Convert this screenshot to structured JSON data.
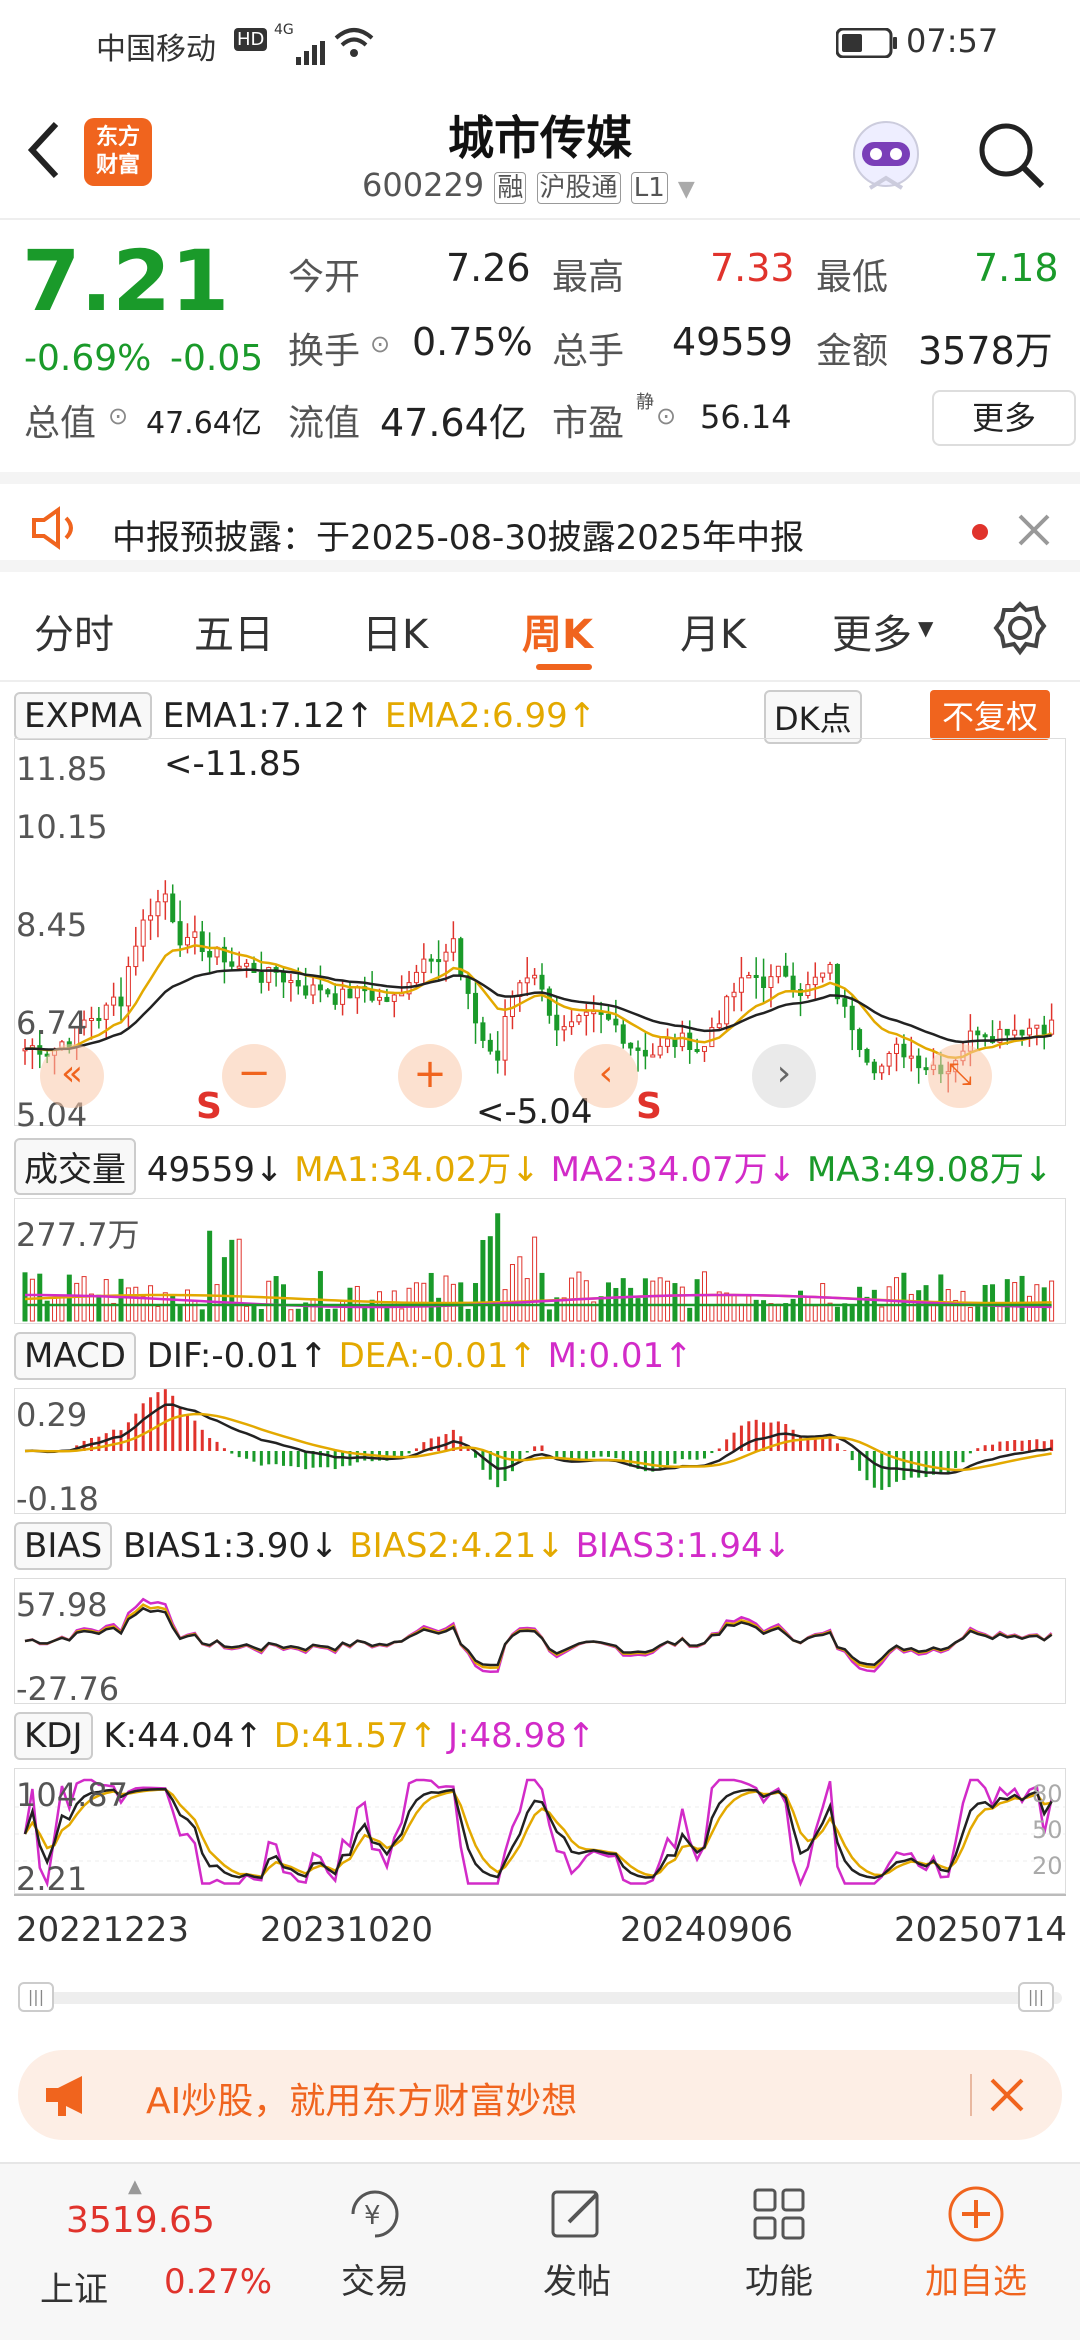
{
  "status_bar": {
    "carrier": "中国移动",
    "hd": "HD",
    "signal_tag": "4G",
    "time": "07:57"
  },
  "header": {
    "logo_text_1": "东方",
    "logo_text_2": "财富",
    "stock_name": "城市传媒",
    "stock_code": "600229",
    "tag_margin": "融",
    "tag_connect": "沪股通",
    "tag_level": "L1"
  },
  "quote": {
    "price": "7.21",
    "change_pct": "-0.69%",
    "change_amt": "-0.05",
    "open_label": "今开",
    "open": "7.26",
    "high_label": "最高",
    "high": "7.33",
    "low_label": "最低",
    "low": "7.18",
    "turnover_label": "换手",
    "turnover": "0.75%",
    "volume_label": "总手",
    "volume": "49559",
    "amount_label": "金额",
    "amount": "3578万",
    "mktcap_label": "总值",
    "mktcap": "47.64亿",
    "float_label": "流值",
    "float_cap": "47.64亿",
    "pe_label": "市盈",
    "pe_sup": "静",
    "pe": "56.14",
    "more": "更多"
  },
  "notice": {
    "text": "中报预披露：于2025-08-30披露2025年中报"
  },
  "tabs": [
    "分时",
    "五日",
    "日K",
    "周K",
    "月K",
    "更多"
  ],
  "active_tab": "周K",
  "main_chart": {
    "indicator": "EXPMA",
    "ema1": "EMA1:7.12↑",
    "ema2": "EMA2:6.99↑",
    "dk_btn": "DK点",
    "fq_btn": "不复权",
    "y_ticks": [
      "11.85",
      "10.15",
      "8.45",
      "6.74",
      "5.04"
    ],
    "max_label": "<-11.85",
    "min_label": "<-5.04",
    "s_marker": "S"
  },
  "volume_panel": {
    "indicator": "成交量",
    "value": "49559↓",
    "ma1": "MA1:34.02万↓",
    "ma2": "MA2:34.07万↓",
    "ma3": "MA3:49.08万↓",
    "y_top": "277.7万"
  },
  "macd_panel": {
    "indicator": "MACD",
    "dif": "DIF:-0.01↑",
    "dea": "DEA:-0.01↑",
    "m": "M:0.01↑",
    "y_top": "0.29",
    "y_bot": "-0.18"
  },
  "bias_panel": {
    "indicator": "BIAS",
    "b1": "BIAS1:3.90↓",
    "b2": "BIAS2:4.21↓",
    "b3": "BIAS3:1.94↓",
    "y_top": "57.98",
    "y_bot": "-27.76"
  },
  "kdj_panel": {
    "indicator": "KDJ",
    "k": "K:44.04↑",
    "d": "D:41.57↑",
    "j": "J:48.98↑",
    "y_top": "104.87",
    "y_bot": "2.21",
    "r80": "80",
    "r50": "50",
    "r20": "20"
  },
  "x_dates": [
    "20221223",
    "20231020",
    "20240906",
    "20250714"
  ],
  "banner": {
    "text": "AI炒股，就用东方财富妙想"
  },
  "bottom_bar": {
    "index_value": "3519.65",
    "index_name": "上证",
    "index_change": "0.27%",
    "trade": "交易",
    "post": "发帖",
    "func": "功能",
    "add": "加自选"
  },
  "colors": {
    "up": "#e0332c",
    "down": "#1a9a2a",
    "accent": "#f0641e",
    "ema2": "#e3a900",
    "magenta": "#d22bc8"
  }
}
